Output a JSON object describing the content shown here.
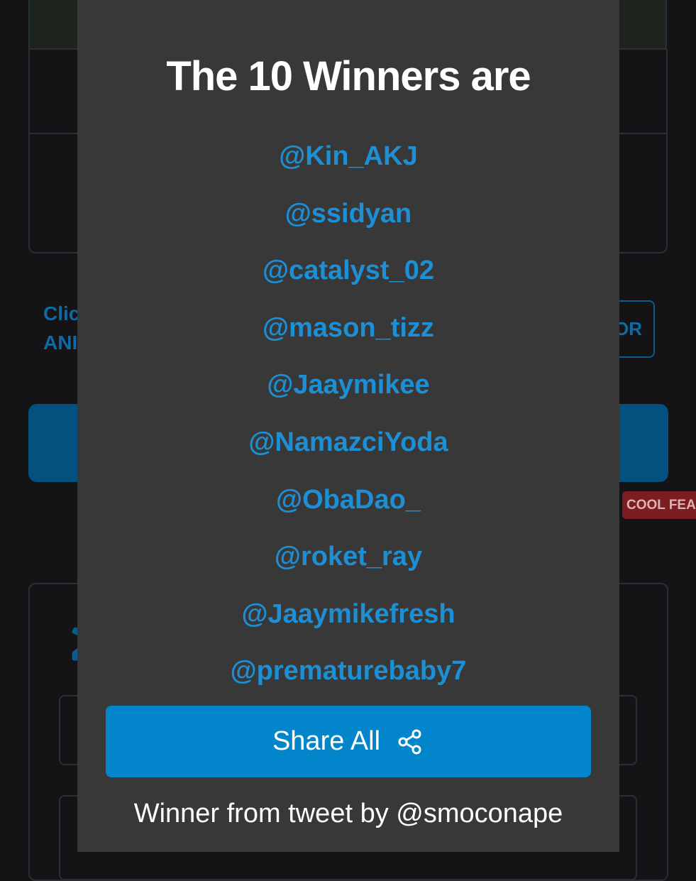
{
  "background": {
    "hint_line1": "Clic",
    "hint_line2": "ANI",
    "outline_button_label": "OR",
    "badge_label": "COOL FEA",
    "gear_icon": "gear-icon"
  },
  "modal": {
    "title": "The 10 Winners are",
    "winners": [
      "@Kin_AKJ",
      "@ssidyan",
      "@catalyst_02",
      "@mason_tizz",
      "@Jaaymikee",
      "@NamazciYoda",
      "@ObaDao_",
      "@roket_ray",
      "@Jaaymikefresh",
      "@prematurebaby7"
    ],
    "share_button": {
      "label": "Share All",
      "icon": "share-icon"
    },
    "footer": "Winner from tweet by @smoconape"
  },
  "colors": {
    "modal_bg": "#383838",
    "link": "#1d8fd4",
    "primary": "#0385cb",
    "page_bg": "#141416"
  }
}
